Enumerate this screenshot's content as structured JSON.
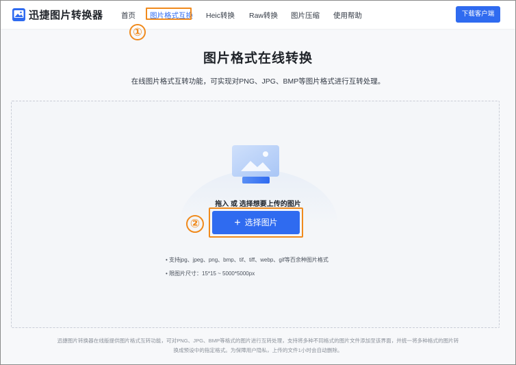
{
  "header": {
    "brand": "迅捷图片转换器",
    "nav": [
      "首页",
      "图片格式互换",
      "Heic转换",
      "Raw转换",
      "图片压缩",
      "使用帮助"
    ],
    "download_button": "下载客户端"
  },
  "callouts": [
    "①",
    "②"
  ],
  "main": {
    "title": "图片格式在线转换",
    "subtitle": "在线图片格式互转功能，可实现对PNG、JPG、BMP等图片格式进行互转处理。",
    "drop_prompt": "拖入 或 选择想要上传的图片",
    "select_button": "选择图片",
    "hints": [
      "• 支持jpg、jpeg、png、bmp、tif、tiff、webp、gif等百余种图片格式",
      "• 限图片尺寸：15*15 ~ 5000*5000px"
    ]
  },
  "footer": {
    "line1": "迅捷图片转换器在线版提供图片格式互转功能，可对PNG、JPG、BMP等格式的图片进行互转处理，支持将多种不同格式的图片文件添加至该界面，并统一将多种格式的图片转",
    "line2": "换成预设中的指定格式。为保障用户隐私，上传的文件1小时会自动删除。"
  },
  "colors": {
    "accent": "#2f6bf0",
    "callout": "#f08a1c"
  },
  "icons": {
    "logo": "image-logo-icon",
    "upload": "image-upload-illustration",
    "plus": "plus-icon"
  }
}
